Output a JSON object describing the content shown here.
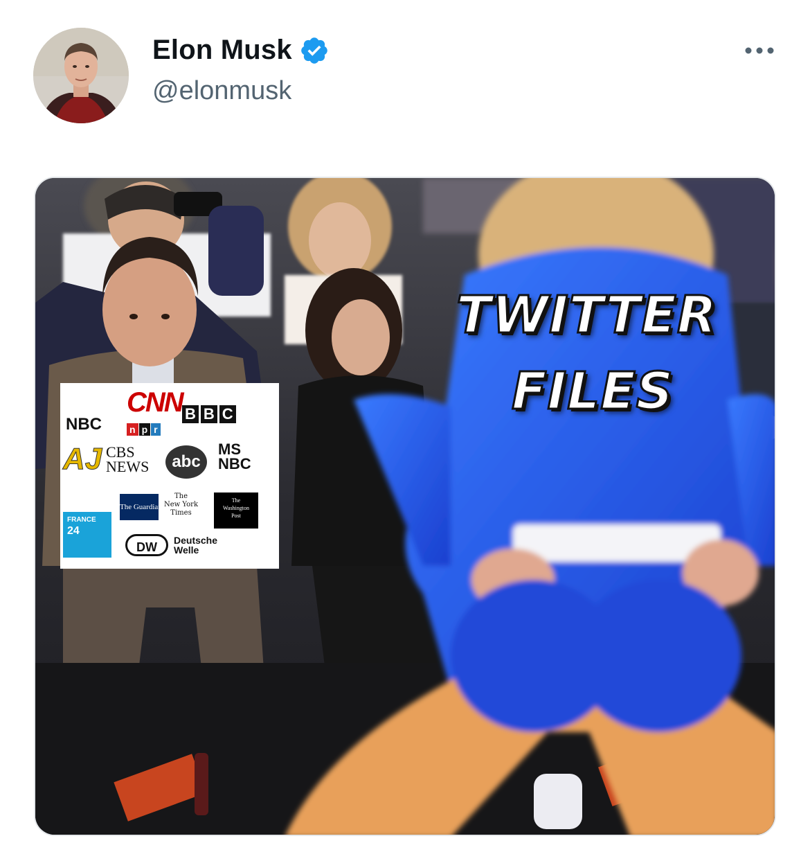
{
  "tweet": {
    "author": {
      "display_name": "Elon Musk",
      "handle": "@elonmusk",
      "verified": true,
      "verified_color": "#1d9bf0"
    },
    "more_icon": "more-horizontal-icon",
    "media": {
      "overlay_line1": "TWITTER",
      "overlay_line2": "FILES",
      "logos": {
        "nbc": "NBC",
        "cnn": "CNN",
        "bbc": [
          "B",
          "B",
          "C"
        ],
        "npr": [
          "n",
          "p",
          "r"
        ],
        "aj": "AJ",
        "cbs": [
          "CBS",
          "NEWS"
        ],
        "abc": "abc",
        "msnbc": [
          "MS",
          "NBC"
        ],
        "guardian": "The Guardian",
        "nyt": [
          "The",
          "New York",
          "Times"
        ],
        "wapo": [
          "The",
          "Washington",
          "Post"
        ],
        "france24": [
          "FRANCE",
          "24"
        ],
        "dw_mark": "DW",
        "dw_name": [
          "Deutsche",
          "Welle"
        ]
      }
    }
  },
  "colors": {
    "text_primary": "#0f1419",
    "text_secondary": "#536471",
    "border": "#e5e8eb"
  }
}
